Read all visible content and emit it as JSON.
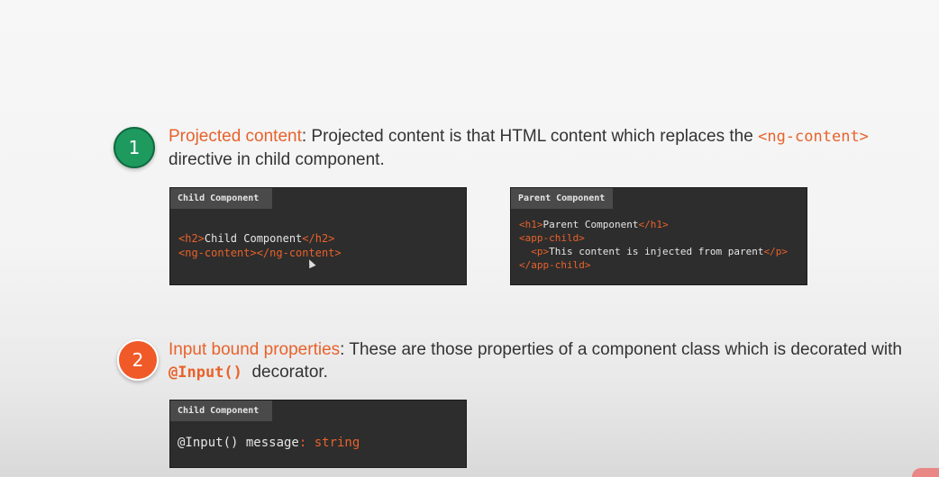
{
  "colors": {
    "accent": "#e8622b",
    "green_badge": "#1e9a5f",
    "orange_badge": "#f05a28",
    "code_bg": "#2d2d2d"
  },
  "point1": {
    "number": "1",
    "term": "Projected content",
    "text_before": ": Projected content is that HTML content which replaces the ",
    "code": "<ng-content>",
    "text_after": " directive in child component."
  },
  "code1": {
    "title": "Child Component",
    "line1_open": "<h2>",
    "line1_text": "Child Component",
    "line1_close": "</h2>",
    "line2": "<ng-content></ng-content>"
  },
  "code2": {
    "title": "Parent Component",
    "line1_open": "<h1>",
    "line1_text": "Parent Component",
    "line1_close": "</h1>",
    "line2": "<app-child>",
    "line3_open": "  <p>",
    "line3_text": "This content is injected from parent",
    "line3_close": "</p>",
    "line4": "</app-child>"
  },
  "point2": {
    "number": "2",
    "term": "Input bound properties",
    "text_before": ": These are those properties of a component class which is decorated with ",
    "code": "@Input()",
    "text_after": "  decorator."
  },
  "code3": {
    "title": "Child Component",
    "decorator": "@Input() message",
    "colon": ": ",
    "type": "string"
  }
}
